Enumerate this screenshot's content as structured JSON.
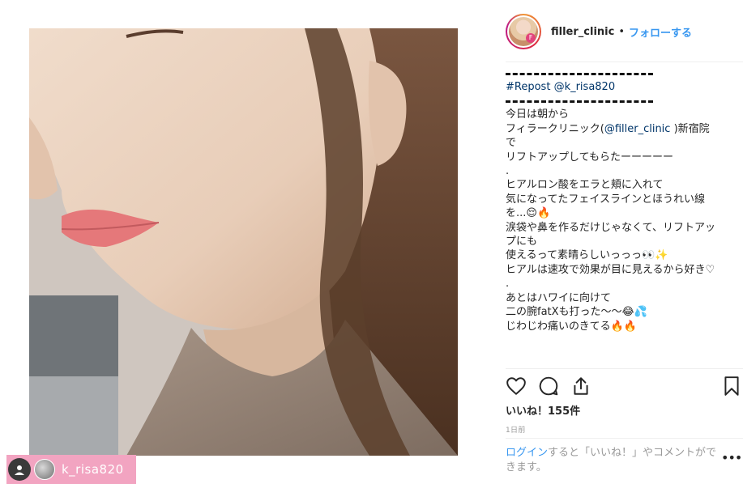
{
  "post": {
    "username": "filler_clinic",
    "separator": "•",
    "follow_label": "フォローする",
    "photo_alt": "",
    "tag_username": "k_risa820"
  },
  "caption": {
    "hashtag": "#Repost",
    "mention_repost": "@k_risa820",
    "lines": [
      "今日は朝から",
      "フィラークリニック(",
      "@filler_clinic",
      " )新宿院",
      "で",
      "リフトアップしてもらたーーーーー",
      ".",
      "ヒアルロン酸をエラと頬に入れて",
      "気になってたフェイスラインとほうれい線を...😌🔥",
      "涙袋や鼻を作るだけじゃなくて、リフトアップにも",
      "使えるって素晴らしいっっっ👀✨",
      "ヒアルは速攻で効果が目に見えるから好き♡",
      ".",
      "あとはハワイに向けて",
      "二の腕fatXも打った〜〜😂💦",
      "じわじわ痛いのきてる🔥🔥"
    ]
  },
  "stats": {
    "likes_label": "いいね！155件",
    "timestamp": "1日前"
  },
  "footer": {
    "login_link": "ログイン",
    "login_rest": "すると「いいね！」やコメントができます。",
    "more_label": "•••"
  },
  "colors": {
    "accent": "#3897f0",
    "tag_badge": "#f2a4c1",
    "text": "#262626",
    "muted": "#999999"
  },
  "icons": {
    "like": "heart-icon",
    "comment": "comment-bubble-icon",
    "share": "share-icon",
    "save": "bookmark-icon"
  }
}
